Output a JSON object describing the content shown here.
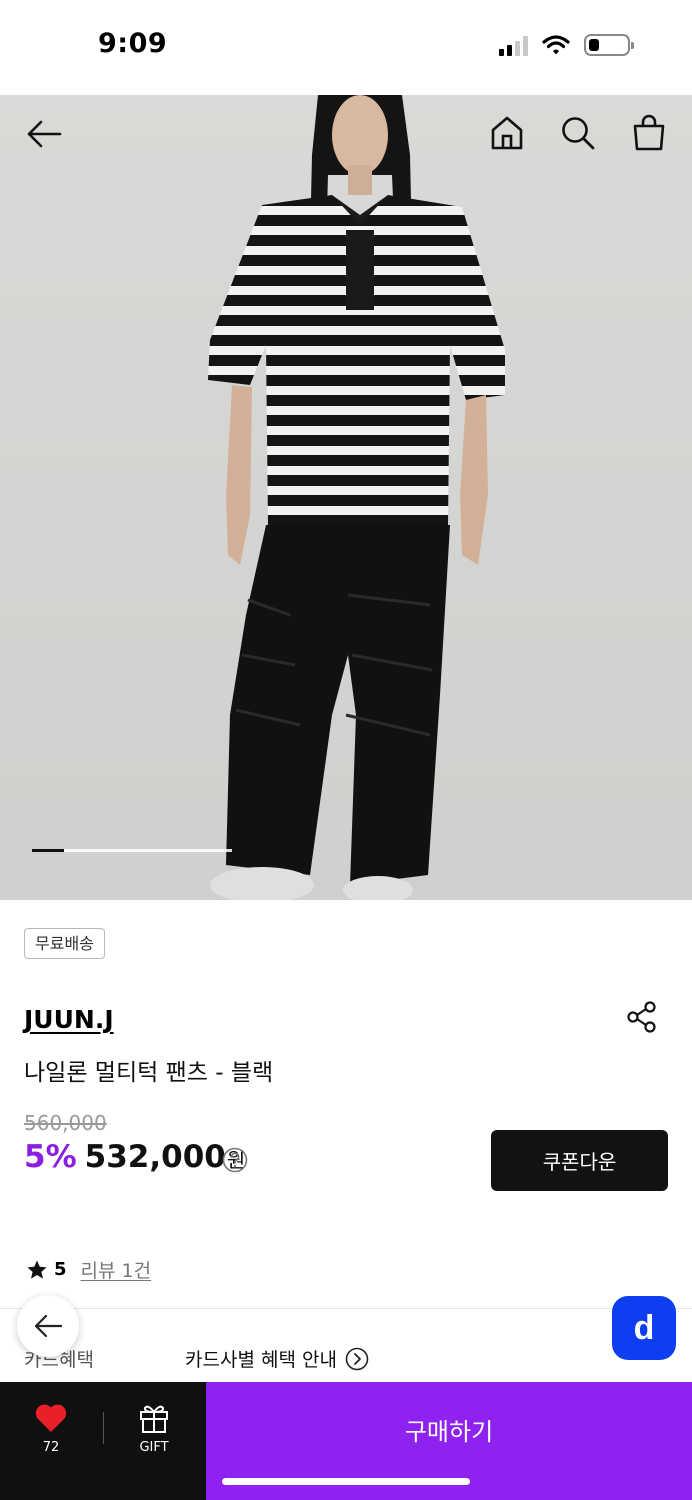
{
  "status_bar": {
    "time": "9:09"
  },
  "hero": {
    "slide_progress": 0.16
  },
  "product": {
    "badge": "무료배송",
    "brand": "JUUN.J",
    "name": "나일론 멀티턱 팬츠 - 블랙",
    "original_price": "560,000",
    "discount": "5%",
    "price": "532,000",
    "currency": "원",
    "coupon_button": "쿠폰다운",
    "rating": "5",
    "review_link": "리뷰 1건"
  },
  "card": {
    "label": "카드혜택",
    "info": "카드사별 혜택 안내"
  },
  "float": {
    "app_button": "d"
  },
  "bottom_bar": {
    "like_count": "72",
    "gift_label": "GIFT",
    "buy_label": "구매하기"
  },
  "colors": {
    "accent": "#8f22f0",
    "discount": "#8b1fe0",
    "like": "#e8202a",
    "app_button": "#0d3ff0"
  },
  "icons": [
    "back-arrow-icon",
    "home-icon",
    "search-icon",
    "shopping-bag-icon",
    "share-icon",
    "help-icon",
    "star-icon",
    "chevron-right-circle-icon",
    "heart-icon",
    "gift-icon"
  ]
}
